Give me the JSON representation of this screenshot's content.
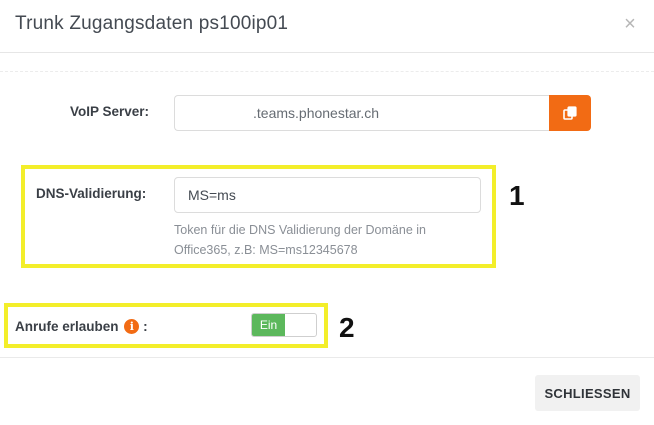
{
  "modal": {
    "title": "Trunk Zugangsdaten ps100ip01",
    "close_icon": "×"
  },
  "voip": {
    "label": "VoIP Server:",
    "value": ".teams.phonestar.ch",
    "copy_icon": "copy-icon"
  },
  "dns": {
    "label": "DNS-Validierung:",
    "value": "MS=ms",
    "help_line1": "Token für die DNS Validierung der Domäne in",
    "help_line2": "Office365, z.B: MS=ms12345678"
  },
  "calls": {
    "label": "Anrufe erlauben",
    "info_icon": "i",
    "colon": ":",
    "toggle_label": "Ein"
  },
  "markers": {
    "one": "1",
    "two": "2"
  },
  "footer": {
    "close_label": "SCHLIESSEN"
  },
  "colors": {
    "accent": "#f26b14",
    "toggle_on": "#5cb85c",
    "highlight": "#f3ee2a"
  }
}
